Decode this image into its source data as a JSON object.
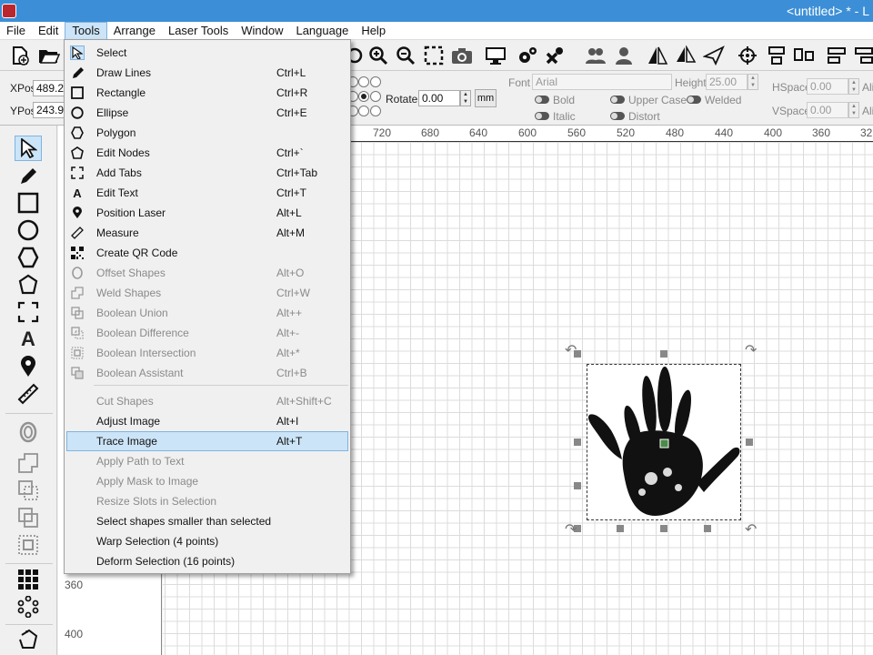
{
  "window": {
    "title": "<untitled> * - L",
    "app_icon": "lightburn-logo-icon"
  },
  "menubar": [
    "File",
    "Edit",
    "Tools",
    "Arrange",
    "Laser Tools",
    "Window",
    "Language",
    "Help"
  ],
  "active_menu": "Tools",
  "position": {
    "xpos_label": "XPos",
    "xpos_value": "489.2",
    "ypos_label": "YPos",
    "ypos_value": "243.9"
  },
  "rotate": {
    "label": "Rotate",
    "value": "0.00",
    "unit": "mm"
  },
  "text_props": {
    "font_label": "Font",
    "font_value": "Arial",
    "height_label": "Height",
    "height_value": "25.00",
    "hspace_label": "HSpace",
    "hspace_value": "0.00",
    "vspace_label": "VSpace",
    "vspace_value": "0.00",
    "align_label_1": "Ali",
    "align_label_2": "Ali",
    "bold": "Bold",
    "italic": "Italic",
    "upper_case": "Upper Case",
    "distort": "Distort",
    "welded": "Welded"
  },
  "ruler": {
    "h_ticks": [
      "720",
      "680",
      "640",
      "600",
      "560",
      "520",
      "480",
      "440",
      "400",
      "360",
      "32"
    ],
    "v_ticks": [
      "360",
      "400"
    ]
  },
  "tools_menu": [
    {
      "label": "Select",
      "shortcut": "",
      "icon": "arrow-cursor-icon",
      "enabled": true
    },
    {
      "label": "Draw Lines",
      "shortcut": "Ctrl+L",
      "icon": "pencil-icon",
      "enabled": true
    },
    {
      "label": "Rectangle",
      "shortcut": "Ctrl+R",
      "icon": "rectangle-icon",
      "enabled": true
    },
    {
      "label": "Ellipse",
      "shortcut": "Ctrl+E",
      "icon": "ellipse-icon",
      "enabled": true
    },
    {
      "label": "Polygon",
      "shortcut": "",
      "icon": "polygon-icon",
      "enabled": true
    },
    {
      "label": "Edit Nodes",
      "shortcut": "Ctrl+`",
      "icon": "edit-nodes-icon",
      "enabled": true
    },
    {
      "label": "Add Tabs",
      "shortcut": "Ctrl+Tab",
      "icon": "add-tabs-icon",
      "enabled": true
    },
    {
      "label": "Edit Text",
      "shortcut": "Ctrl+T",
      "icon": "text-icon",
      "enabled": true
    },
    {
      "label": "Position Laser",
      "shortcut": "Alt+L",
      "icon": "map-pin-icon",
      "enabled": true
    },
    {
      "label": "Measure",
      "shortcut": "Alt+M",
      "icon": "ruler-icon",
      "enabled": true
    },
    {
      "label": "Create QR Code",
      "shortcut": "",
      "icon": "qr-code-icon",
      "enabled": true
    },
    {
      "label": "Offset Shapes",
      "shortcut": "Alt+O",
      "icon": "offset-icon",
      "enabled": false
    },
    {
      "label": "Weld Shapes",
      "shortcut": "Ctrl+W",
      "icon": "weld-icon",
      "enabled": false
    },
    {
      "label": "Boolean Union",
      "shortcut": "Alt++",
      "icon": "boolean-union-icon",
      "enabled": false
    },
    {
      "label": "Boolean Difference",
      "shortcut": "Alt+-",
      "icon": "boolean-difference-icon",
      "enabled": false
    },
    {
      "label": "Boolean Intersection",
      "shortcut": "Alt+*",
      "icon": "boolean-intersection-icon",
      "enabled": false
    },
    {
      "label": "Boolean Assistant",
      "shortcut": "Ctrl+B",
      "icon": "boolean-assistant-icon",
      "enabled": false
    },
    {
      "label": "Cut Shapes",
      "shortcut": "Alt+Shift+C",
      "icon": "",
      "enabled": false
    },
    {
      "label": "Adjust Image",
      "shortcut": "Alt+I",
      "icon": "",
      "enabled": true
    },
    {
      "label": "Trace Image",
      "shortcut": "Alt+T",
      "icon": "",
      "enabled": true,
      "highlighted": true
    },
    {
      "label": "Apply Path to Text",
      "shortcut": "",
      "icon": "",
      "enabled": false
    },
    {
      "label": "Apply Mask to Image",
      "shortcut": "",
      "icon": "",
      "enabled": false
    },
    {
      "label": "Resize Slots in Selection",
      "shortcut": "",
      "icon": "",
      "enabled": false
    },
    {
      "label": "Select shapes smaller than selected",
      "shortcut": "",
      "icon": "",
      "enabled": true
    },
    {
      "label": "Warp Selection (4 points)",
      "shortcut": "",
      "icon": "",
      "enabled": true
    },
    {
      "label": "Deform Selection (16 points)",
      "shortcut": "",
      "icon": "",
      "enabled": true
    }
  ],
  "canvas_object": {
    "type": "image",
    "depicts": "handprint"
  }
}
